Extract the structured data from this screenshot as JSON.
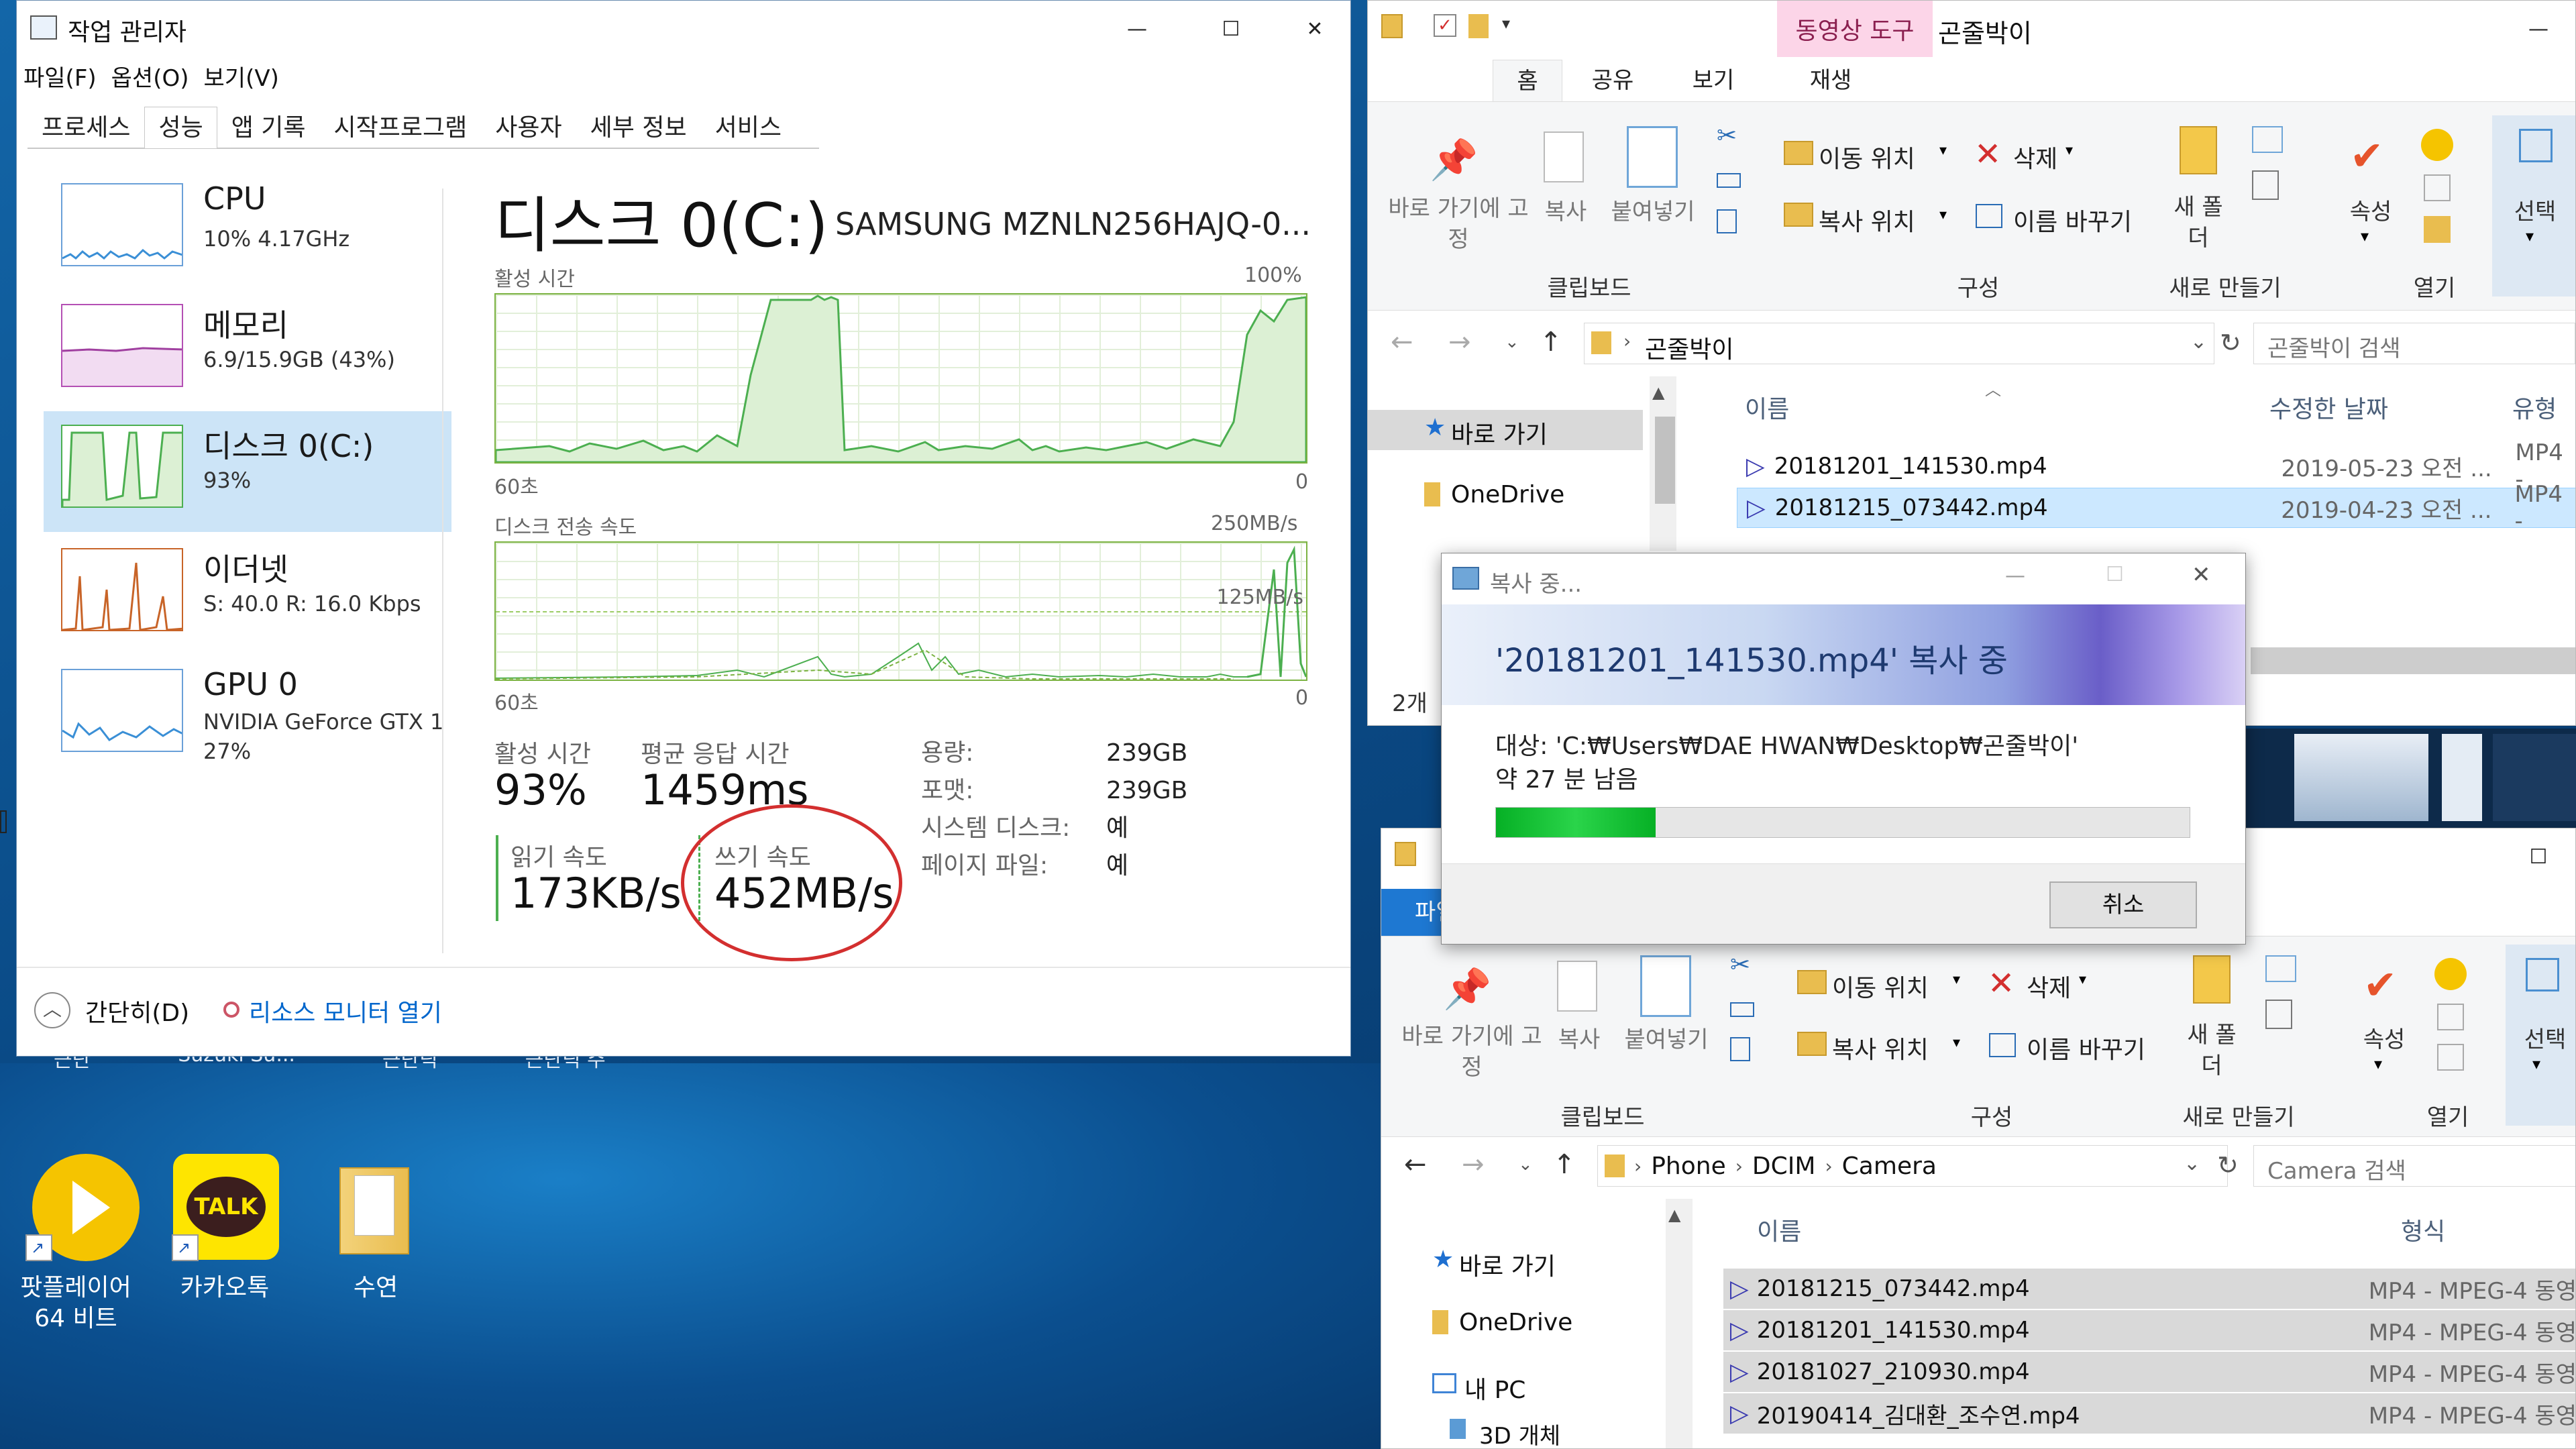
{
  "taskmgr": {
    "title": "작업 관리자",
    "menu": [
      "파일(F)",
      "옵션(O)",
      "보기(V)"
    ],
    "tabs": [
      "프로세스",
      "성능",
      "앱 기록",
      "시작프로그램",
      "사용자",
      "세부 정보",
      "서비스"
    ],
    "active_tab": "성능",
    "sidebar": [
      {
        "title": "CPU",
        "sub": "10% 4.17GHz"
      },
      {
        "title": "메모리",
        "sub": "6.9/15.9GB (43%)"
      },
      {
        "title": "디스크 0(C:)",
        "sub": "93%"
      },
      {
        "title": "이더넷",
        "sub": "S: 40.0  R: 16.0 Kbps"
      },
      {
        "title": "GPU 0",
        "sub": "NVIDIA GeForce GTX 1",
        "sub2": "27%"
      }
    ],
    "main": {
      "title": "디스크 0(C:)",
      "model": "SAMSUNG MZNLN256HAJQ-0...",
      "chart1_label": "활성 시간",
      "chart1_max": "100%",
      "chart1_left": "60초",
      "chart1_right": "0",
      "chart2_label": "디스크 전송 속도",
      "chart2_max": "250MB/s",
      "chart2_mid": "125MB/s",
      "chart2_left": "60초",
      "chart2_right": "0",
      "active_time_label": "활성 시간",
      "active_time_value": "93%",
      "resp_label": "평균 응답 시간",
      "resp_value": "1459ms",
      "read_label": "읽기 속도",
      "read_value": "173KB/s",
      "write_label": "쓰기 속도",
      "write_value": "452MB/s",
      "props": [
        {
          "k": "용량:",
          "v": "239GB"
        },
        {
          "k": "포맷:",
          "v": "239GB"
        },
        {
          "k": "시스템 디스크:",
          "v": "예"
        },
        {
          "k": "페이지 파일:",
          "v": "예"
        }
      ]
    },
    "footer_simple": "간단히(D)",
    "footer_monitor": "리소스 모니터 열기"
  },
  "desktop": {
    "icons": [
      {
        "label": "팟플레이어",
        "label2": "64 비트"
      },
      {
        "label": "카카오톡",
        "badge": "TALK"
      },
      {
        "label": "수연"
      }
    ],
    "hidden_labels": [
      "근단",
      "Suzuki Su...",
      "근단딕",
      "근단딕 주"
    ]
  },
  "explorer1": {
    "tool_tab": "동영상 도구",
    "title": "곤줄박이",
    "tabs": [
      "홈",
      "공유",
      "보기",
      "재생"
    ],
    "ribbon": {
      "pin": "바로 가기에 고정",
      "copy": "복사",
      "paste": "붙여넣기",
      "move_to": "이동 위치",
      "copy_to": "복사 위치",
      "delete": "삭제",
      "rename": "이름 바꾸기",
      "new_folder": "새 폴더",
      "properties": "속성",
      "select": "선택",
      "group_clipboard": "클립보드",
      "group_organize": "구성",
      "group_new": "새로 만들기",
      "group_open": "열기"
    },
    "path": [
      "곤줄박이"
    ],
    "search_placeholder": "곤줄박이 검색",
    "nav": [
      "바로 가기",
      "OneDrive"
    ],
    "columns": [
      "이름",
      "수정한 날짜",
      "유형"
    ],
    "files": [
      {
        "name": "20181201_141530.mp4",
        "date": "2019-05-23 오전 ...",
        "type": "MP4 -"
      },
      {
        "name": "20181215_073442.mp4",
        "date": "2019-04-23 오전 ...",
        "type": "MP4 -"
      }
    ],
    "status": "2개"
  },
  "copy_dialog": {
    "title": "복사 중...",
    "heading": "'20181201_141530.mp4' 복사 중",
    "dest": "대상: 'C:₩Users₩DAE HWAN₩Desktop₩곤줄박이'",
    "remaining": "약 27 분 남음",
    "progress": 0.23,
    "cancel": "취소"
  },
  "explorer2": {
    "tab_partial": "파일",
    "ribbon": {
      "pin": "바로 가기에 고정",
      "copy": "복사",
      "paste": "붙여넣기",
      "move_to": "이동 위치",
      "copy_to": "복사 위치",
      "delete": "삭제",
      "rename": "이름 바꾸기",
      "new_folder": "새 폴더",
      "properties": "속성",
      "select": "선택",
      "group_clipboard": "클립보드",
      "group_organize": "구성",
      "group_new": "새로 만들기",
      "group_open": "열기"
    },
    "path": [
      "Phone",
      "DCIM",
      "Camera"
    ],
    "search_placeholder": "Camera 검색",
    "nav": [
      "바로 가기",
      "OneDrive",
      "내 PC",
      "3D 개체"
    ],
    "columns": [
      "이름",
      "형식"
    ],
    "files": [
      {
        "name": "20181215_073442.mp4",
        "type": "MP4 - MPEG-4 동영"
      },
      {
        "name": "20181201_141530.mp4",
        "type": "MP4 - MPEG-4 동영"
      },
      {
        "name": "20181027_210930.mp4",
        "type": "MP4 - MPEG-4 동영"
      },
      {
        "name": "20190414_김대환_조수연.mp4",
        "type": "MP4 - MPEG-4 동영"
      }
    ]
  },
  "colors": {
    "accent": "#0078d7",
    "disk_green": "#4caf50",
    "annotation_red": "#d32f2f"
  }
}
